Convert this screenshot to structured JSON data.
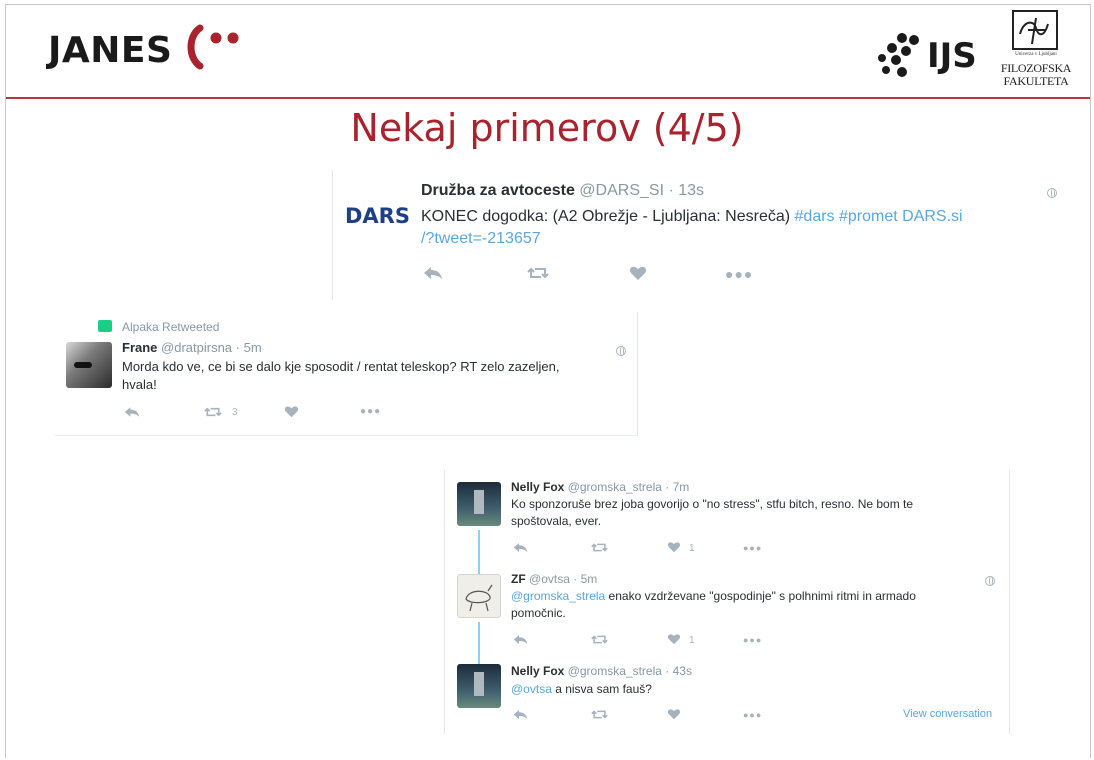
{
  "header": {
    "left_logo": "JANES",
    "right_logo": "IJS",
    "faculty_small": "Univerza v Ljubljani",
    "faculty_line1": "FILOZOFSKA",
    "faculty_line2": "FAKULTETA"
  },
  "slide_title": "Nekaj primerov (4/5)",
  "colors": {
    "accent": "#a8232e",
    "link": "#5aa8db",
    "muted": "#8899a6"
  },
  "tweet1": {
    "avatar_text": "DARS",
    "name": "Družba za avtoceste",
    "handle": "@DARS_SI",
    "time": "· 13s",
    "text": "KONEC dogodka: (A2 Obrežje - Ljubljana: Nesreča) ",
    "hashtags": "#dars #promet",
    "link1": "DARS.si",
    "link2": "/?tweet=-213657"
  },
  "tweet2": {
    "retweeted_by": "Alpaka Retweeted",
    "name": "Frane",
    "handle": "@dratpirsna",
    "time": "· 5m",
    "text_line1": "Morda kdo ve, ce bi se dalo kje sposodit / rentat teleskop? RT zelo zazeljen,",
    "text_line2": "hvala!",
    "retweet_count": "3"
  },
  "thread": {
    "t1": {
      "name": "Nelly Fox",
      "handle": "@gromska_strela",
      "time": "· 7m",
      "text_line1": "Ko sponzoruše brez joba govorijo o \"no stress\", stfu bitch, resno. Ne bom te",
      "text_line2": "spoštovala, ever.",
      "like_count": "1"
    },
    "t2": {
      "name": "ZF",
      "handle": "@ovtsa",
      "time": "· 5m",
      "mention": "@gromska_strela",
      "text_line1": " enako vzdrževane \"gospodinje\" s polhnimi ritmi in armado",
      "text_line2": "pomočnic.",
      "like_count": "1"
    },
    "t3": {
      "name": "Nelly Fox",
      "handle": "@gromska_strela",
      "time": "· 43s",
      "mention": "@ovtsa",
      "text": " a nisva sam fauš?",
      "view_conversation": "View conversation"
    }
  },
  "icons": {
    "reply": "reply-icon",
    "retweet": "retweet-icon",
    "like": "heart-icon",
    "more": "more-icon",
    "globe": "globe-icon"
  }
}
